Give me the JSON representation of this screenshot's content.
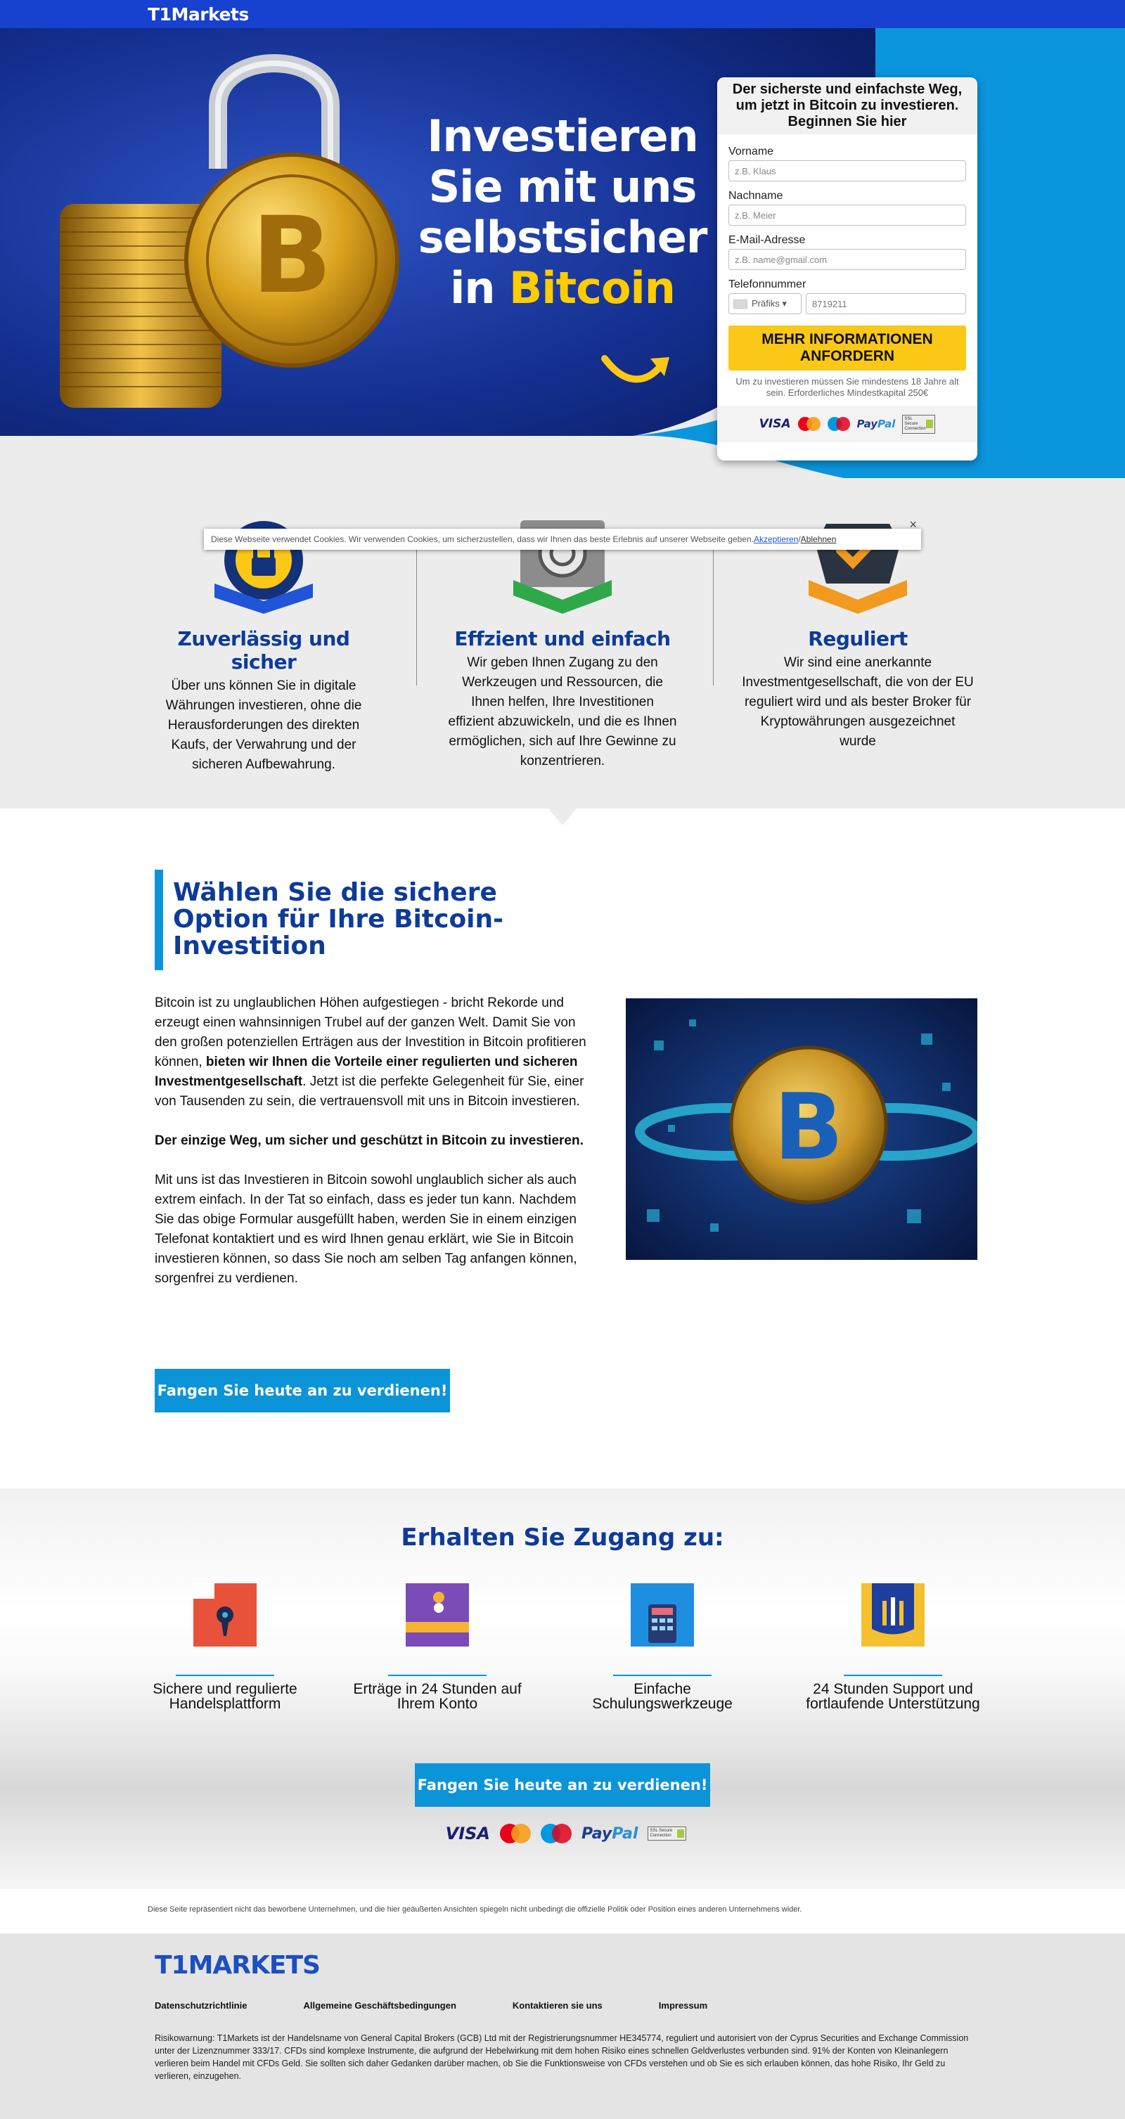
{
  "brand": {
    "name": "T1Markets",
    "footer_logo": "T1MARKETS"
  },
  "hero": {
    "headline_main": "Investieren Sie mit uns selbstsicher in ",
    "headline_highlight": "Bitcoin"
  },
  "form": {
    "heading": "Der sicherste und einfachste Weg, um jetzt in Bitcoin zu investieren. Beginnen Sie hier",
    "fields": {
      "first_name": {
        "label": "Vorname",
        "placeholder": "z.B. Klaus"
      },
      "last_name": {
        "label": "Nachname",
        "placeholder": "z.B. Meier"
      },
      "email": {
        "label": "E-Mail-Adresse",
        "placeholder": "z.B. name@gmail.com"
      },
      "phone": {
        "label": "Telefonnummer",
        "prefix": "Präfiks ▾",
        "placeholder": "8719211"
      }
    },
    "submit": "MEHR INFORMATIONEN ANFORDERN",
    "note": "Um zu investieren müssen Sie mindestens 18 Jahre alt sein. Erforderliches Mindestkapital 250€"
  },
  "payments": {
    "visa": "VISA",
    "mastercard": "mastercard",
    "maestro": "maestro",
    "paypal_a": "Pay",
    "paypal_b": "Pal",
    "ssl": "SSL Secure Connection"
  },
  "cookie": {
    "text": "Diese Webseite verwendet Cookies. Wir verwenden Cookies, um sicherzustellen, dass wir Ihnen das beste Erlebnis auf unserer Webseite geben. ",
    "accept": "Akzeptieren",
    "separator": " / ",
    "decline": "Ablehnen",
    "close": "×"
  },
  "features": [
    {
      "title": "Zuverlässig und sicher",
      "text": "Über uns können Sie in digitale Währungen investieren, ohne die Herausforderungen des direkten Kaufs, der Verwahrung und der sicheren Aufbewahrung."
    },
    {
      "title": "Effzient und einfach",
      "text": "Wir geben Ihnen Zugang zu den Werkzeugen und Ressourcen, die Ihnen helfen, Ihre Investitionen effizient abzuwickeln, und die es Ihnen ermöglichen, sich auf Ihre Gewinne zu konzentrieren."
    },
    {
      "title": "Reguliert",
      "text": "Wir sind eine anerkannte Investmentgesellschaft, die von der EU reguliert wird und als bester Broker für Kryptowährungen ausgezeichnet wurde"
    }
  ],
  "content": {
    "heading": "Wählen Sie die sichere Option für Ihre Bitcoin-Investition",
    "p1_a": "Bitcoin ist zu unglaublichen Höhen aufgestiegen - bricht Rekorde und erzeugt einen wahnsinnigen Trubel auf der ganzen Welt. Damit Sie von den großen potenziellen Erträgen aus der Investition in Bitcoin profitieren können, ",
    "p1_b": "bieten wir Ihnen die Vorteile einer regulierten und sicheren Investmentgesellschaft",
    "p1_c": ". Jetzt ist die perfekte Gelegenheit für Sie, einer von Tausenden zu sein, die vertrauensvoll mit uns in Bitcoin investieren.",
    "p2": "Der einzige Weg, um sicher und geschützt in Bitcoin zu investieren.",
    "p3": "Mit uns ist das Investieren in Bitcoin sowohl unglaublich sicher als auch extrem einfach. In der Tat so einfach, dass es jeder tun kann. Nachdem Sie das obige Formular ausgefüllt haben, werden Sie in einem einzigen Telefonat kontaktiert und es wird Ihnen genau erklärt, wie Sie in Bitcoin investieren können, so dass Sie noch am selben Tag anfangen können, sorgenfrei zu verdienen.",
    "cta": "Fangen Sie heute an zu verdienen!"
  },
  "access": {
    "title": "Erhalten Sie Zugang zu:",
    "items": [
      {
        "label": "Sichere und regulierte Handelsplattform"
      },
      {
        "label": "Erträge in 24 Stunden auf Ihrem Konto"
      },
      {
        "label": "Einfache Schulungswerkzeuge"
      },
      {
        "label": "24 Stunden Support und fortlaufende Unterstützung"
      }
    ],
    "cta": "Fangen Sie heute an zu verdienen!"
  },
  "disclaimer": "Diese Seite repräsentiert nicht das beworbene Unternehmen, und die hier geäußerten Ansichten spiegeln nicht unbedingt die offizielle Politik oder Position eines anderen Unternehmens wider.",
  "footer": {
    "links": [
      "Datenschutzrichtlinie",
      "Allgemeine Geschäftsbedingungen",
      "Kontaktieren sie uns",
      "Impressum"
    ],
    "risk": "Risikowarnung: T1Markets ist der Handelsname von General Capital Brokers (GCB) Ltd mit der Registrierungsnummer HE345774, reguliert und autorisiert von der Cyprus Securities and Exchange Commission unter der Lizenznummer 333/17. CFDs sind komplexe Instrumente, die aufgrund der Hebelwirkung mit dem hohen Risiko eines schnellen Geldverlustes verbunden sind. 91% der Konten von Kleinanlegern verlieren beim Handel mit CFDs Geld. Sie sollten sich daher Gedanken darüber machen, ob Sie die Funktionsweise von CFDs verstehen und ob Sie es sich erlauben können, das hohe Risiko, Ihr Geld zu verlieren, einzugehen."
  },
  "colors": {
    "brand_blue": "#1741cf",
    "navy": "#0d3b99",
    "accent": "#0c94d8",
    "yellow": "#fcc817"
  }
}
